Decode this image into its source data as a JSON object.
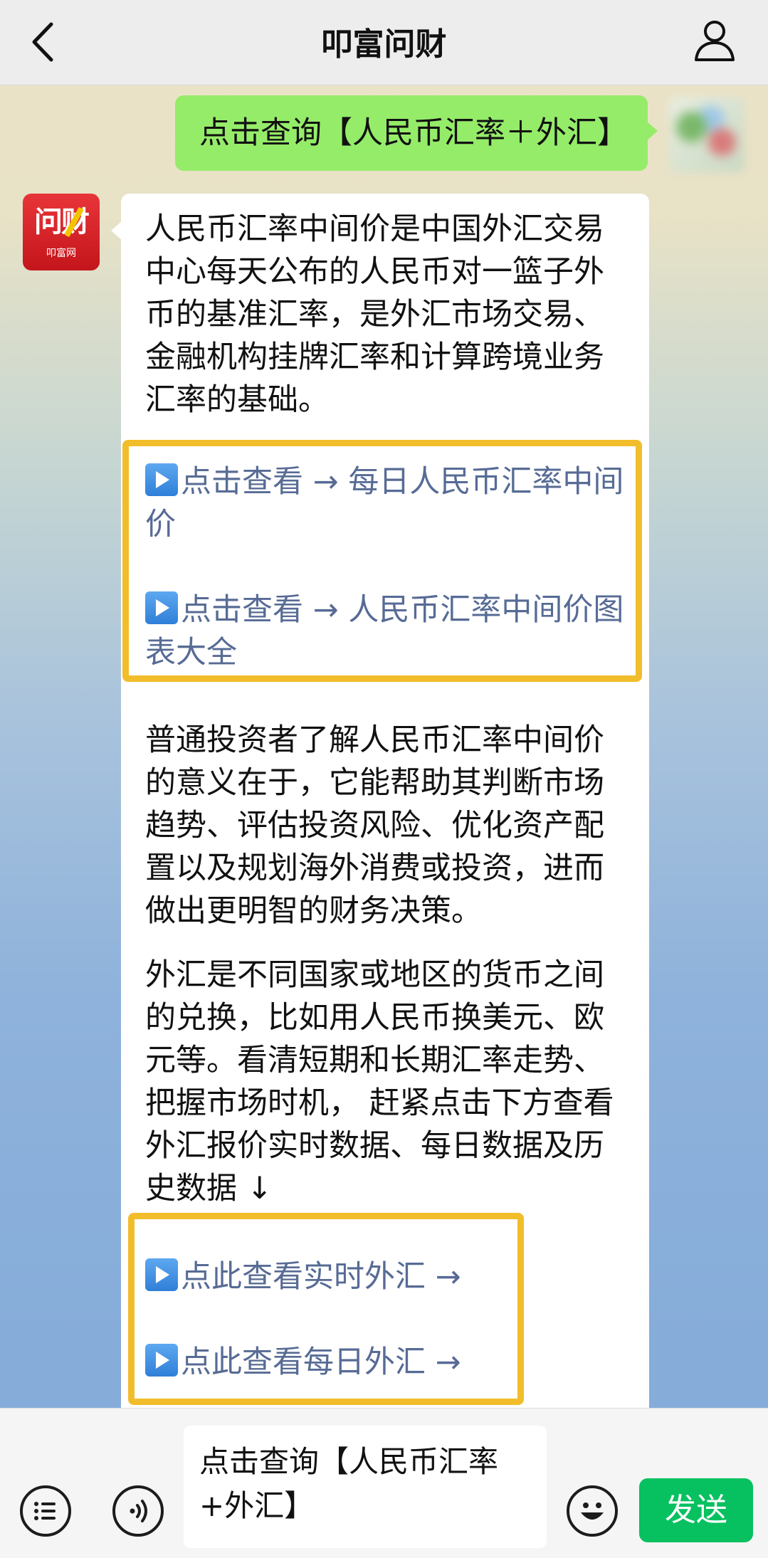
{
  "header": {
    "title": "叩富问财"
  },
  "messages": {
    "sent_text": "点击查询【人民币汇率＋外汇】",
    "bot_avatar": {
      "big_text": "问财",
      "small_text": "叩富网"
    },
    "reply": {
      "para1_lines": [
        "人民币汇率中间价是中国外汇交易",
        "中心每天公布的人民币对一篮子外",
        "币的基准汇率，是外汇市场交易、",
        "金融机构挂牌汇率和计算跨境业务",
        "汇率的基础。"
      ],
      "link1_lines": [
        "点击查看 → 每日人民币汇率中间",
        "价"
      ],
      "link2_lines": [
        "点击查看 → 人民币汇率中间价图",
        "表大全"
      ],
      "para2_lines": [
        "普通投资者了解人民币汇率中间价",
        "的意义在于，它能帮助其判断市场",
        "趋势、评估投资风险、优化资产配",
        "置以及规划海外消费或投资，进而",
        "做出更明智的财务决策。"
      ],
      "para3_lines": [
        "外汇是不同国家或地区的货币之间",
        "的兑换，比如用人民币换美元、欧",
        "元等。看清短期和长期汇率走势、",
        "把握市场时机， 赶紧点击下方查看",
        "外汇报价实时数据、每日数据及历",
        "史数据 ↓"
      ],
      "link3": "点此查看实时外汇 →",
      "link4": "点此查看每日外汇 →"
    }
  },
  "composer": {
    "input_lines": [
      "点击查询【人民币汇率",
      "+外汇】"
    ],
    "send_label": "发送"
  },
  "colors": {
    "sent_bubble": "#95ec69",
    "link": "#576b95",
    "highlight_border": "#f2bd2b",
    "send_button": "#07c160"
  }
}
